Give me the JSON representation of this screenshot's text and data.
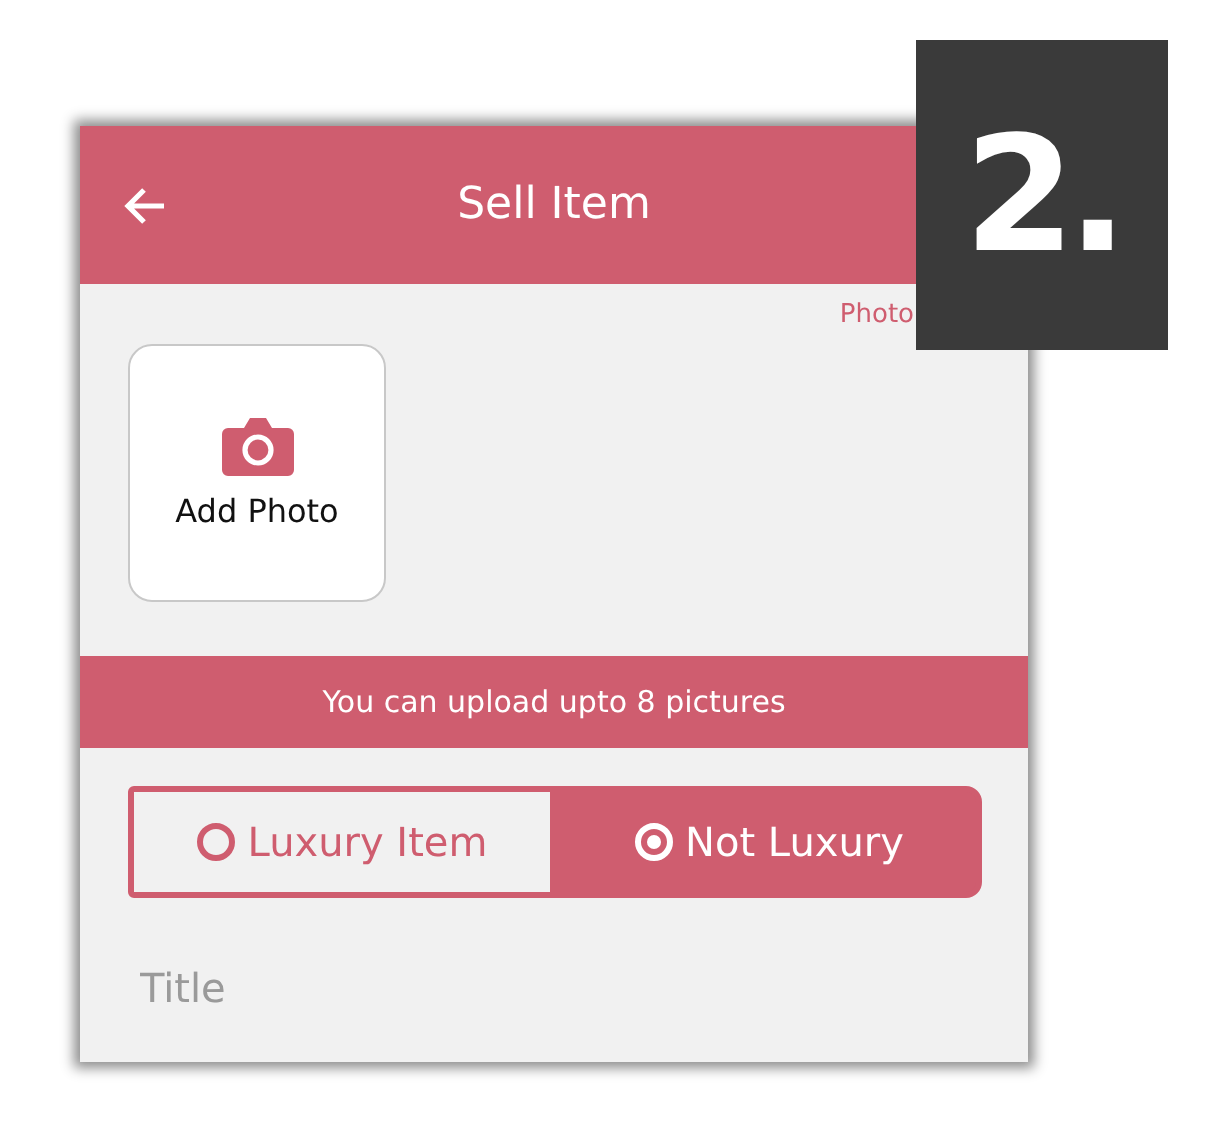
{
  "step_badge": "2.",
  "header": {
    "title": "Sell Item"
  },
  "photo_hint": "Photo",
  "add_photo": {
    "label": "Add Photo"
  },
  "upload_banner": "You can upload upto 8 pictures",
  "luxury_options": [
    {
      "label": "Luxury Item",
      "selected": false
    },
    {
      "label": "Not Luxury",
      "selected": true
    }
  ],
  "title_field": {
    "placeholder": "Title"
  }
}
